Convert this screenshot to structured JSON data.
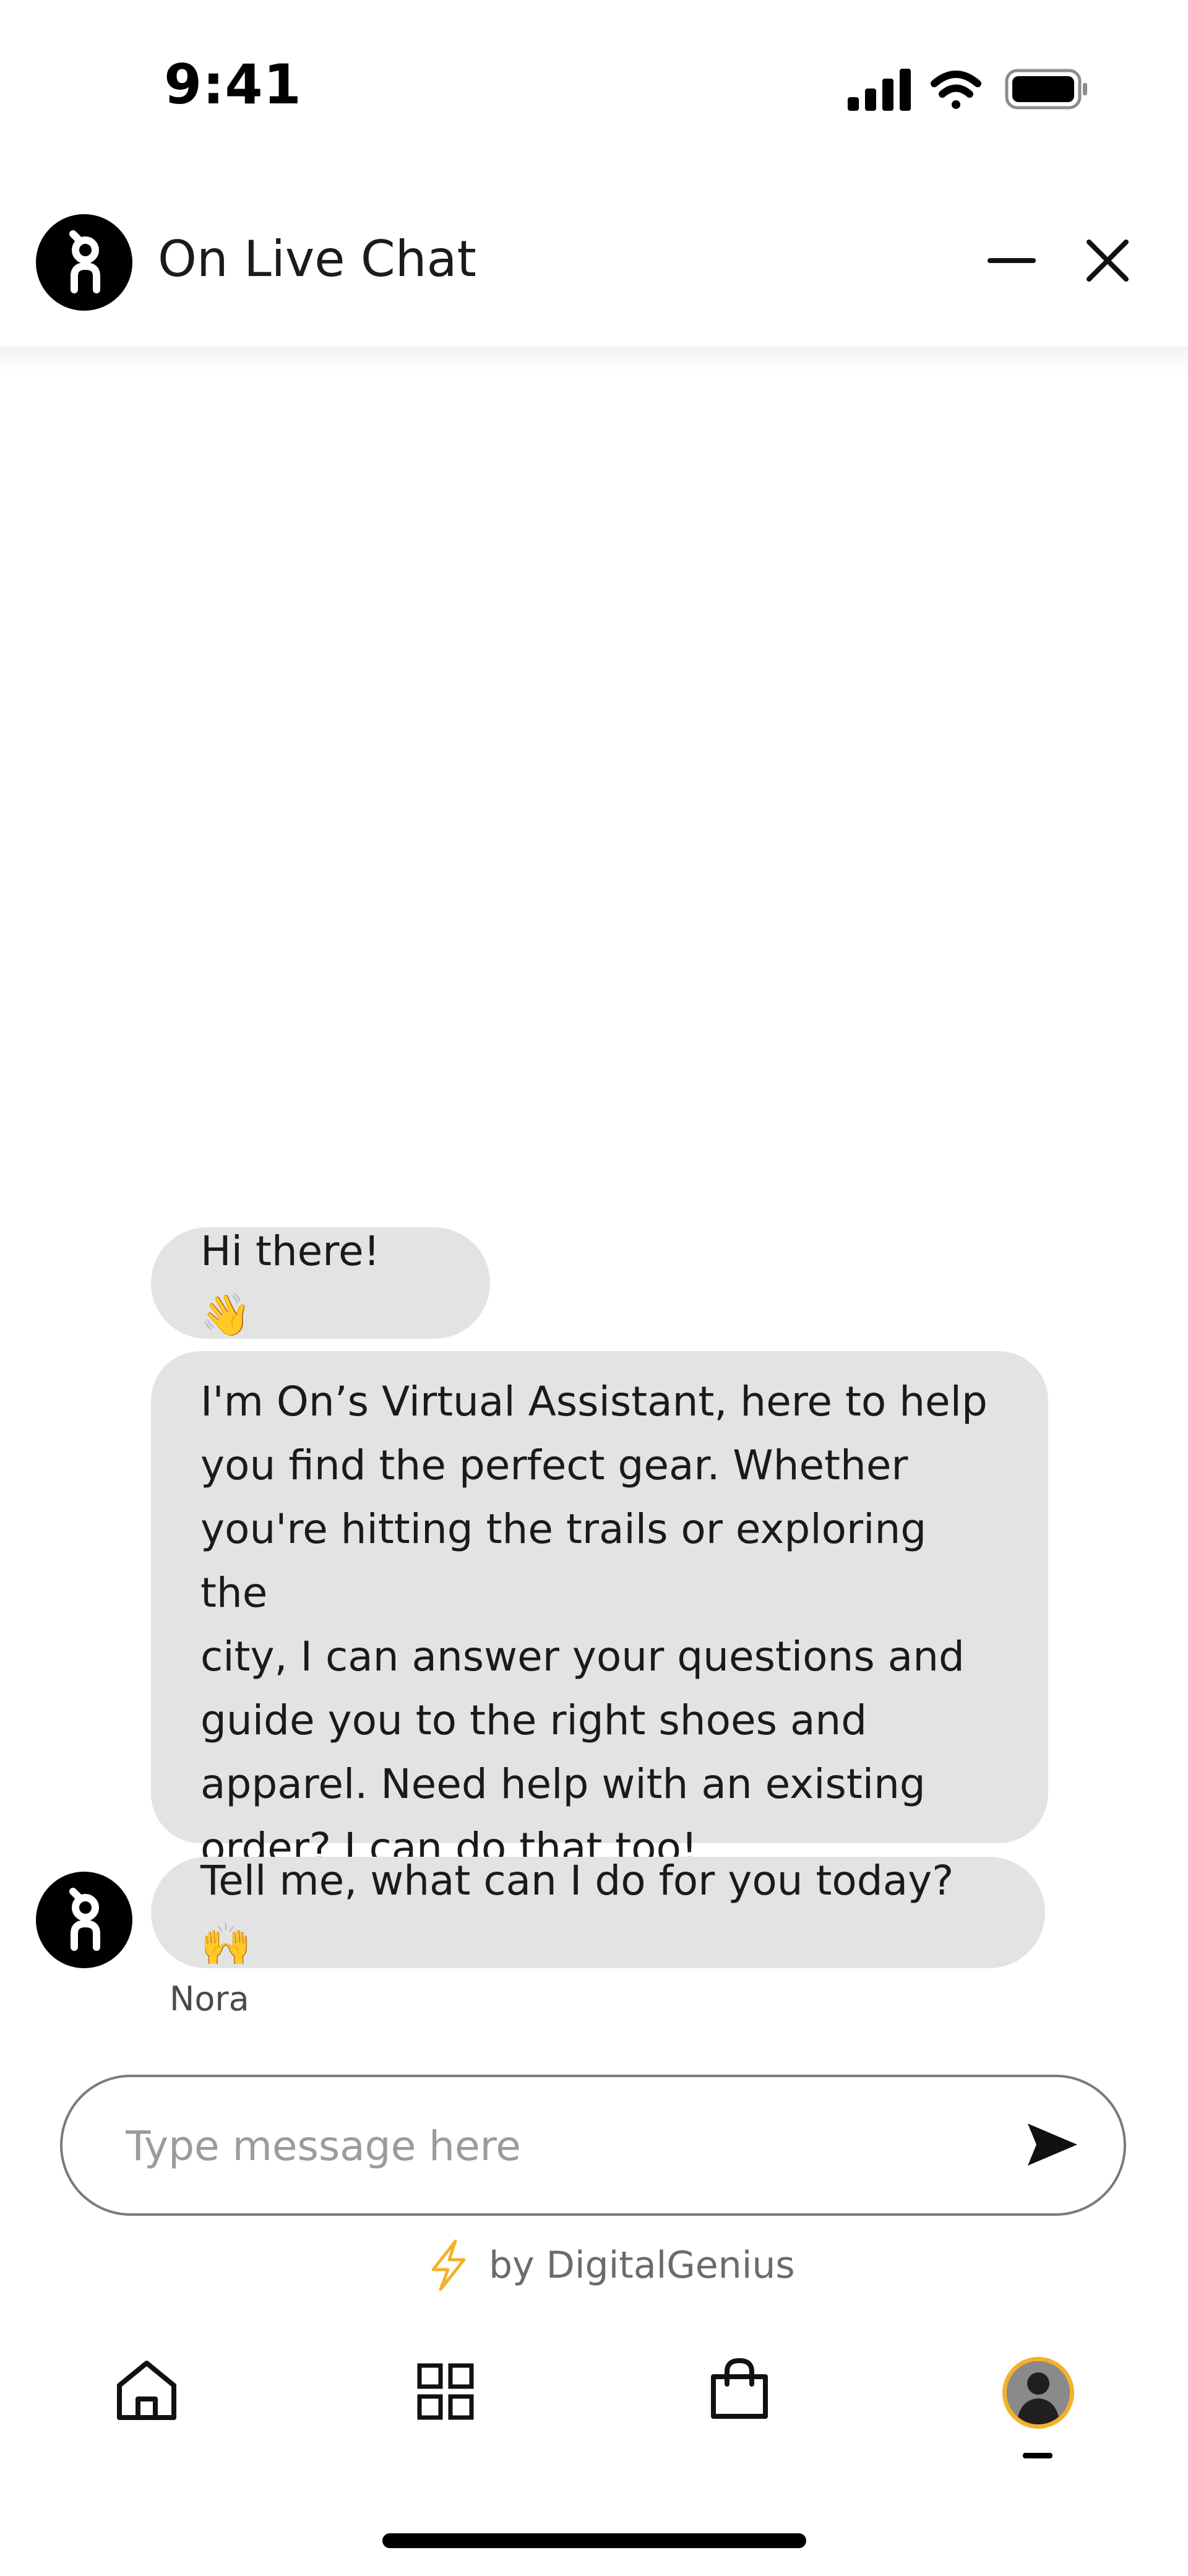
{
  "status_bar": {
    "time": "9:41",
    "icons": [
      "cellular-signal-icon",
      "wifi-icon",
      "battery-icon"
    ]
  },
  "header": {
    "logo_icon": "on-logo-icon",
    "title": "On Live Chat",
    "minimize_icon": "minimize-icon",
    "close_icon": "close-icon"
  },
  "chat": {
    "messages": [
      {
        "text": "Hi there! 👋"
      },
      {
        "lines": [
          "I'm On’s Virtual Assistant, here to help",
          "you find the perfect gear. Whether",
          "you're hitting the trails or exploring the",
          "city, I can answer your questions and",
          "guide you to the right shoes and",
          "apparel. Need help with an existing",
          "order? I can do that too!"
        ]
      },
      {
        "text": "Tell me, what can I do for you today? 🙌"
      }
    ],
    "agent_name": "Nora"
  },
  "composer": {
    "placeholder": "Type message here",
    "value": "",
    "send_icon": "send-icon"
  },
  "footer": {
    "powered_by": "by DigitalGenius",
    "icon": "lightning-icon"
  },
  "bottom_nav": {
    "items": [
      "home-icon",
      "grid-icon",
      "shopping-bag-icon",
      "profile-avatar"
    ],
    "active_index": 3
  },
  "colors": {
    "bubble_bg": "#e3e3e3",
    "accent_ring": "#f2b22a",
    "lightning": "#f2b22a"
  }
}
